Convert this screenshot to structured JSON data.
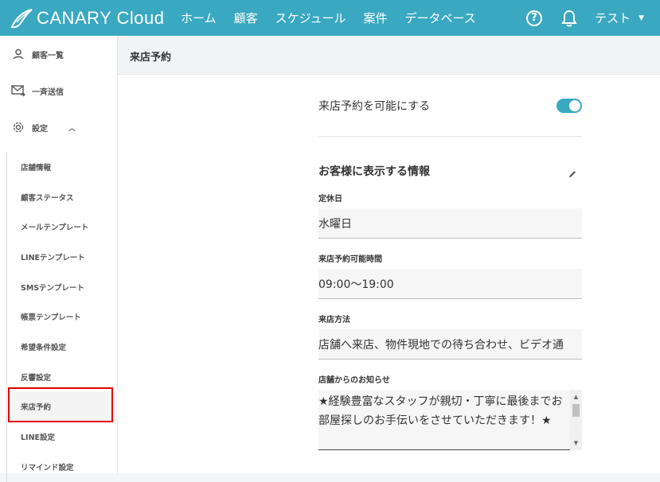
{
  "header": {
    "logo_text": "CANARY Cloud",
    "nav": [
      "ホーム",
      "顧客",
      "スケジュール",
      "案件",
      "データベース"
    ],
    "help_glyph": "?",
    "user_label": "テスト",
    "icons": {
      "help": "help-icon",
      "bell": "bell-icon",
      "caret": "caret-down-icon"
    }
  },
  "sidebar": {
    "top_items": [
      {
        "label": "顧客一覧",
        "icon": "person-icon"
      },
      {
        "label": "一斉送信",
        "icon": "mail-send-icon"
      },
      {
        "label": "設定",
        "icon": "gear-icon",
        "expanded": true
      }
    ],
    "sub_items": [
      "店舗情報",
      "顧客ステータス",
      "メールテンプレート",
      "LINEテンプレート",
      "SMSテンプレート",
      "帳票テンプレート",
      "希望条件設定",
      "反響設定",
      "来店予約",
      "LINE設定",
      "リマインド設定"
    ],
    "active_item": "来店予約"
  },
  "page": {
    "title": "来店予約",
    "toggle_label": "来店予約を可能にする",
    "toggle_on": true,
    "section_title": "お客様に表示する情報",
    "fields": [
      {
        "label": "定休日",
        "value": "水曜日"
      },
      {
        "label": "来店予約可能時間",
        "value": "09:00〜19:00"
      },
      {
        "label": "来店方法",
        "value": "店舗へ来店、物件現地での待ち合わせ、ビデオ通"
      }
    ],
    "notice_label": "店舗からのお知らせ",
    "notice_text": "★経験豊富なスタッフが親切・丁寧に最後までお部屋探しのお手伝いをさせていただきます！★",
    "accent_color": "#3aa8c1",
    "highlight_color": "#e00000"
  }
}
